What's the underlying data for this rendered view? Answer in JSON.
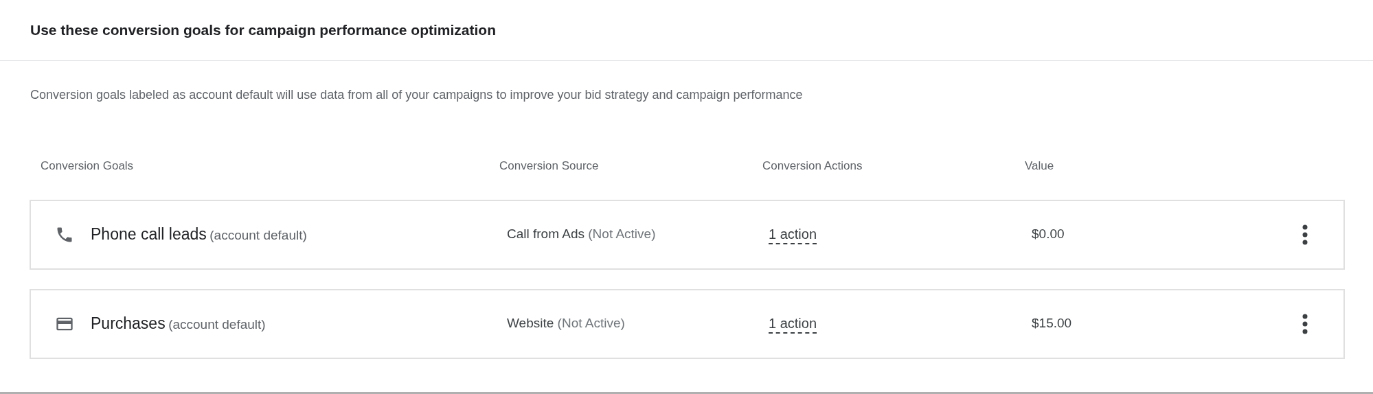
{
  "title": "Use these conversion goals for campaign performance optimization",
  "description": "Conversion goals labeled as account default will use data from all of your campaigns to improve your bid strategy and campaign performance",
  "table": {
    "columns": [
      "Conversion Goals",
      "Conversion Source",
      "Conversion Actions",
      "Value"
    ],
    "rows": [
      {
        "kind": "phone",
        "name": "Phone call leads",
        "name_note": "(account default)",
        "source": "Call from Ads",
        "source_note": "(Not Active)",
        "actions": "1 action",
        "value": "$0.00"
      },
      {
        "kind": "card",
        "name": "Purchases",
        "name_note": "(account default)",
        "source": "Website",
        "source_note": "(Not Active)",
        "actions": "1 action",
        "value": "$15.00"
      }
    ]
  }
}
